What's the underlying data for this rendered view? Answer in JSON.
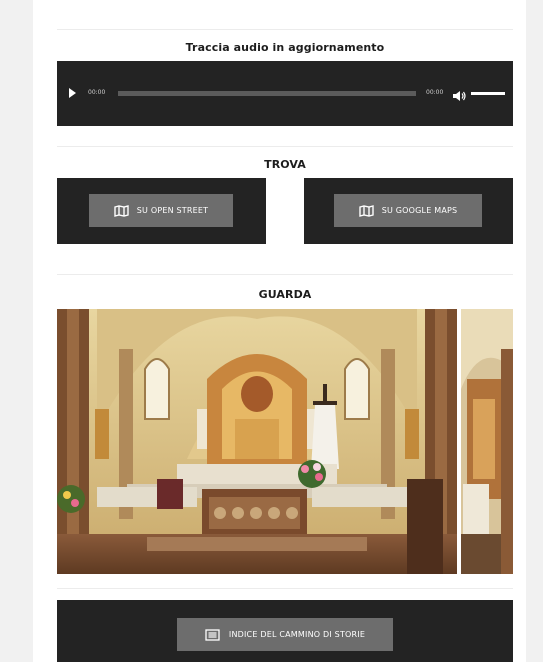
{
  "audio": {
    "title": "Traccia audio in aggiornamento",
    "current_time": "00:00",
    "total_time": "00:00",
    "progress": 0,
    "volume": 1
  },
  "find": {
    "title": "TROVA",
    "open_street_label": "SU OPEN STREET",
    "google_maps_label": "SU GOOGLE MAPS",
    "icon": "map-icon"
  },
  "gallery": {
    "title": "GUARDA"
  },
  "index": {
    "label": "INDICE DEL CAMMINO DI STORIE",
    "icon": "list-icon"
  },
  "colors": {
    "dark_panel": "#232323",
    "button_gray": "#6d6d6d",
    "text_dark": "#1d1d1d"
  }
}
